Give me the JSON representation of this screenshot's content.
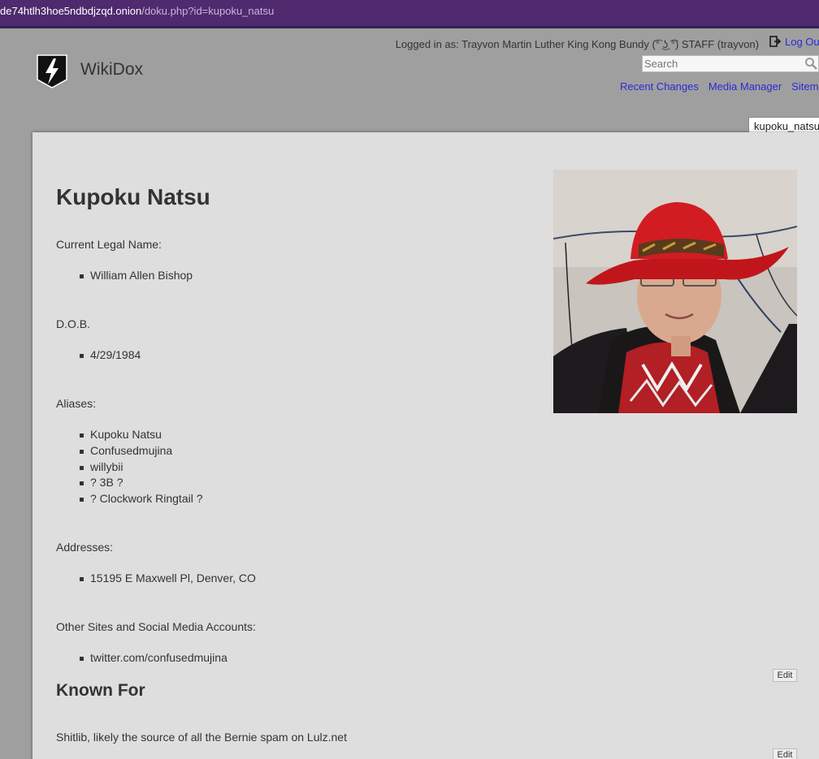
{
  "browser": {
    "url_host": "de74htlh3hoe5ndbdjzqd.onion",
    "url_path": "/doku.php?id=kupoku_natsu"
  },
  "header": {
    "site_title": "WikiDox",
    "logged_in_text": "Logged in as: Trayvon Martin Luther King Kong Bundy (͡° ͜ʖ ͡°) STAFF (trayvon)",
    "logout_label": "Log Out",
    "search_placeholder": "Search",
    "tools": [
      "Recent Changes",
      "Media Manager",
      "Sitemap"
    ],
    "page_id": "kupoku_natsu"
  },
  "article": {
    "title": "Kupoku Natsu",
    "legal_name_label": "Current Legal Name:",
    "legal_name_items": [
      "William Allen Bishop"
    ],
    "dob_label": "D.O.B.",
    "dob_items": [
      "4/29/1984"
    ],
    "aliases_label": "Aliases:",
    "aliases_items": [
      "Kupoku Natsu",
      "Confusedmujina",
      "willybii",
      "? 3B ?",
      "? Clockwork Ringtail ?"
    ],
    "addresses_label": "Addresses:",
    "addresses_items": [
      "15195 E Maxwell Pl, Denver, CO"
    ],
    "sites_label": "Other Sites and Social Media Accounts:",
    "sites_items": [
      "twitter.com/confusedmujina"
    ],
    "known_for_heading": "Known For",
    "known_for_text": "Shitlib, likely the source of all the Bernie spam on Lulz.net",
    "edit_label": "Edit"
  },
  "colors": {
    "url_bar": "#4f2a6e",
    "page_background": "#9f9f9f",
    "panel_background": "#dedede",
    "link": "#2b2bd8"
  }
}
